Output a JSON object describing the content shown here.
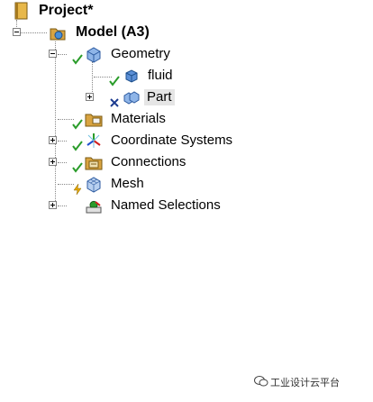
{
  "tree": {
    "project_label": "Project*",
    "model_label": "Model (A3)",
    "items": [
      {
        "label": "Geometry"
      },
      {
        "label": "fluid"
      },
      {
        "label": "Part"
      },
      {
        "label": "Materials"
      },
      {
        "label": "Coordinate Systems"
      },
      {
        "label": "Connections"
      },
      {
        "label": "Mesh"
      },
      {
        "label": "Named Selections"
      }
    ]
  },
  "watermark": {
    "text": "工业设计云平台"
  },
  "colors": {
    "check": "#2a9c2a",
    "cross": "#1b3a8f",
    "lightning": "#e6a800",
    "folder": "#d9a441",
    "body_blue": "#5b8fd6"
  }
}
